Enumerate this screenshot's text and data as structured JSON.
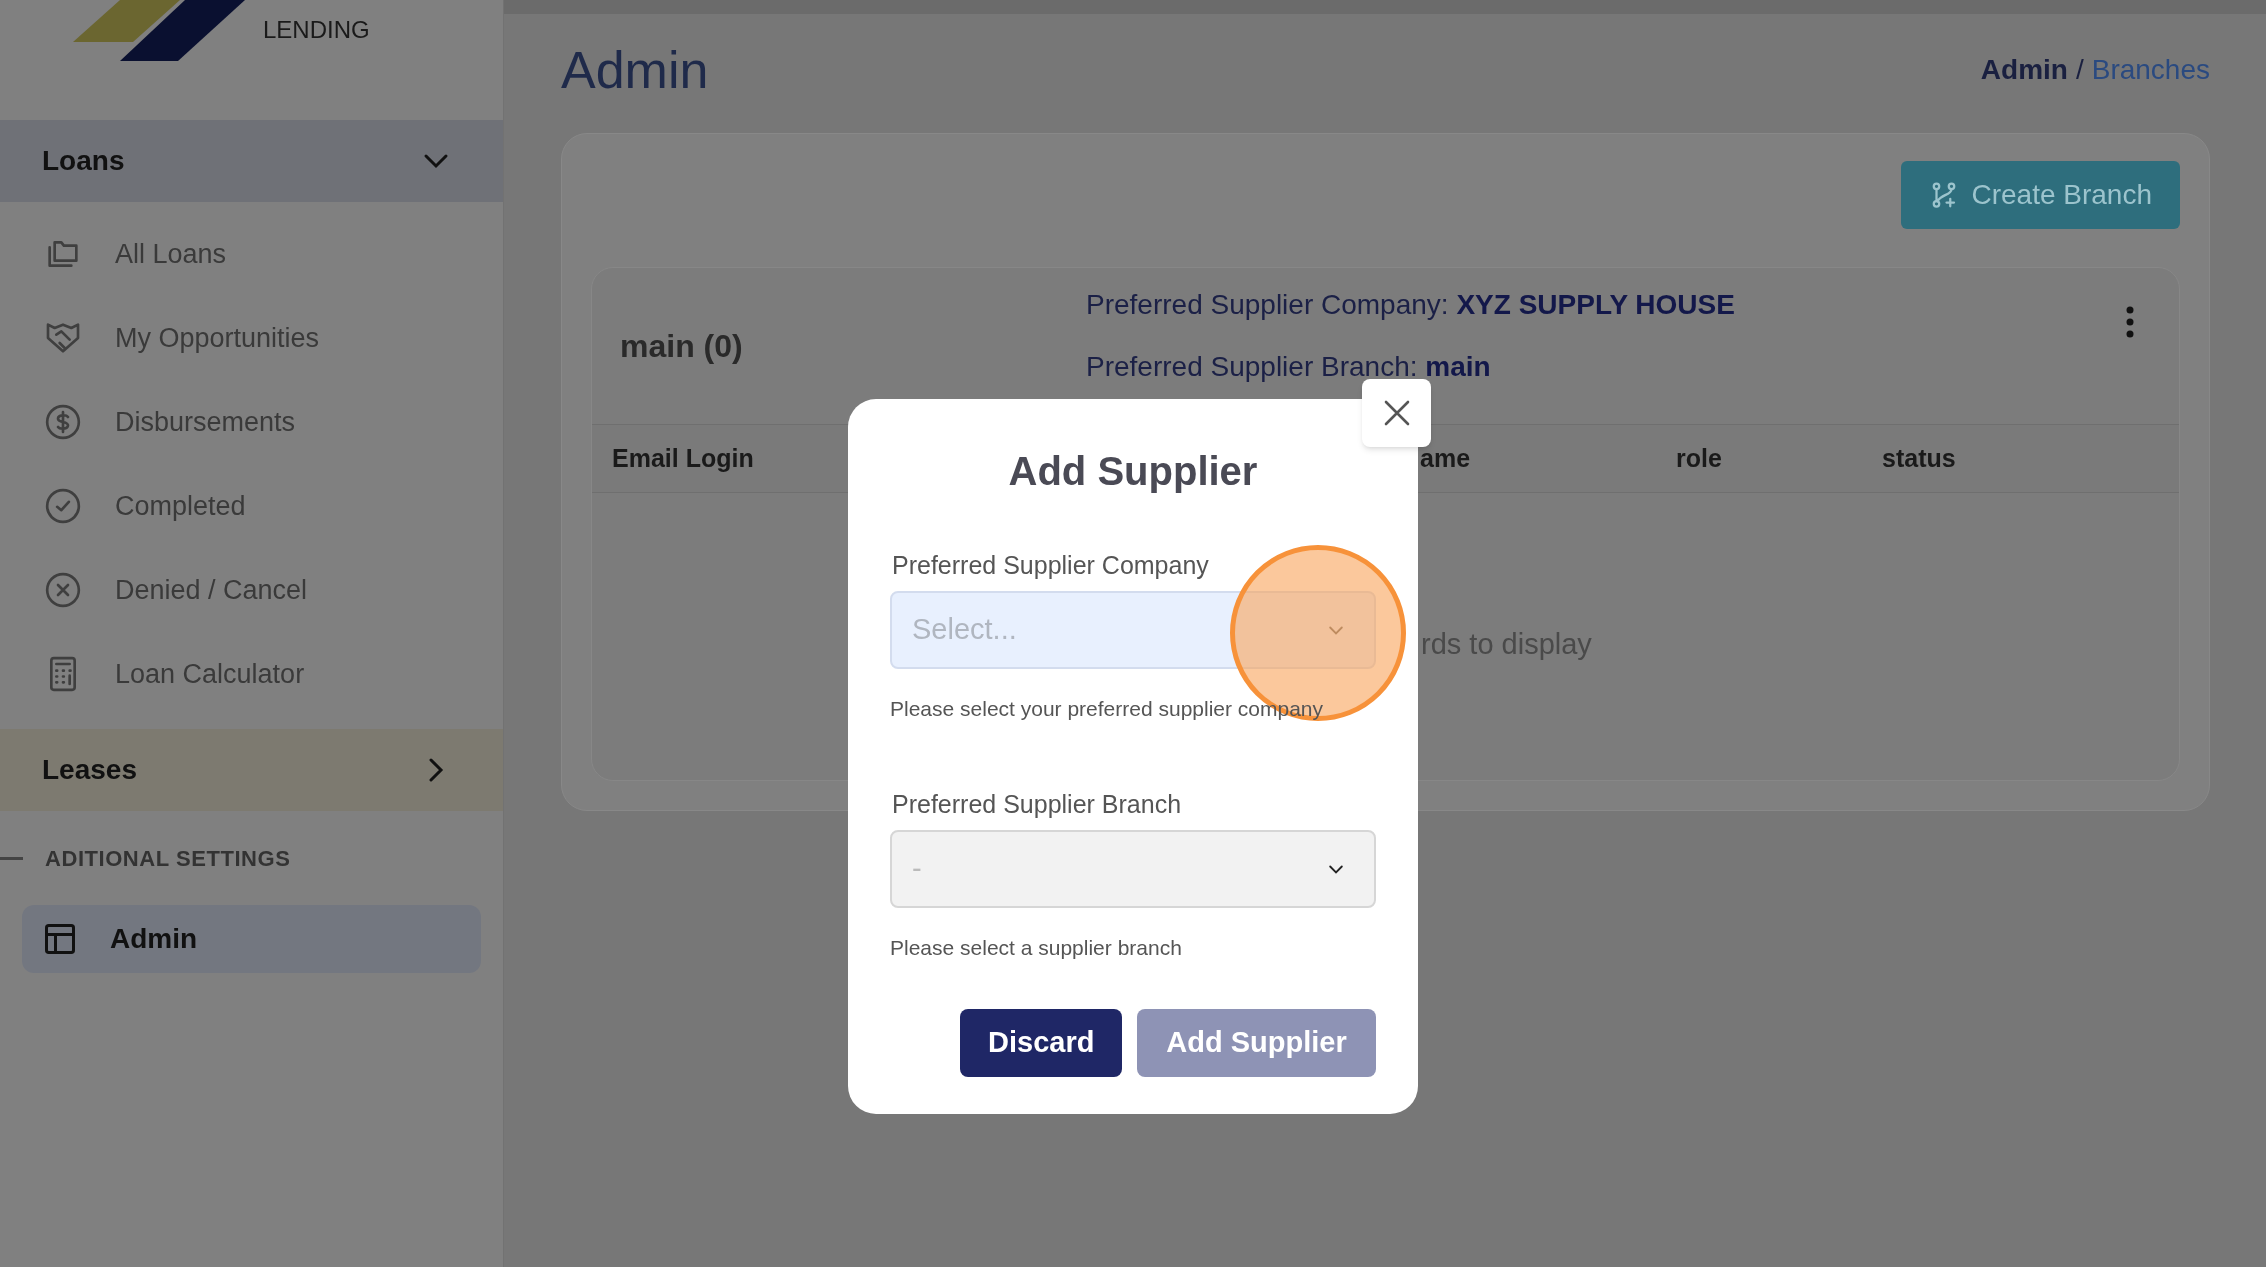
{
  "sidebar": {
    "logo": {
      "tagline": "LENDING"
    },
    "sections": [
      {
        "label": "Loans",
        "expanded": true,
        "items": [
          {
            "label": "All Loans",
            "selected": false
          },
          {
            "label": "My Opportunities",
            "selected": false
          },
          {
            "label": "Disbursements",
            "selected": false
          },
          {
            "label": "Completed",
            "selected": false
          },
          {
            "label": "Denied / Cancel",
            "selected": false
          },
          {
            "label": "Loan Calculator",
            "selected": false
          }
        ]
      },
      {
        "label": "Leases",
        "expanded": false
      }
    ],
    "settings_heading": "ADITIONAL SETTINGS",
    "settings_items": [
      {
        "label": "Admin",
        "selected": true
      }
    ]
  },
  "page_title": "Admin",
  "breadcrumb": {
    "items": [
      "Admin",
      "Branches"
    ],
    "separator": "/"
  },
  "create_button": "Create Branch",
  "branch": {
    "name": "main (0)",
    "details": [
      {
        "label": "Preferred Supplier Company:",
        "value": "XYZ SUPPLY HOUSE"
      },
      {
        "label": "Preferred Supplier Branch:",
        "value": "main"
      }
    ],
    "columns": [
      "Email Login",
      "ame",
      "role",
      "status"
    ],
    "empty_message": "rds to display"
  },
  "modal": {
    "title": "Add Supplier",
    "fields": [
      {
        "label": "Preferred Supplier Company",
        "placeholder": "Select...",
        "help": "Please select your preferred supplier company",
        "disabled": false
      },
      {
        "label": "Preferred Supplier Branch",
        "placeholder": "-",
        "help": "Please select a supplier branch",
        "disabled": true
      }
    ],
    "buttons": [
      {
        "label": "Discard",
        "disabled": false
      },
      {
        "label": "Add Supplier",
        "disabled": true
      }
    ]
  }
}
